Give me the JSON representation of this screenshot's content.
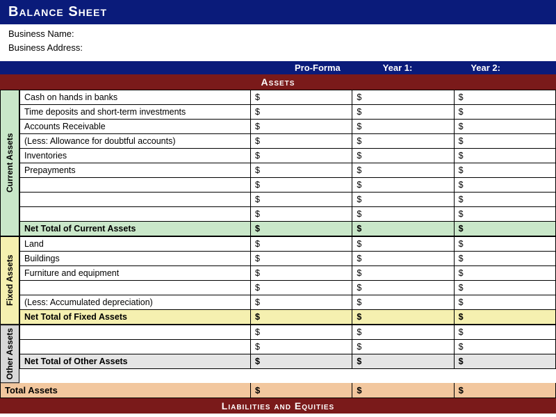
{
  "title": "Balance Sheet",
  "meta": {
    "businessNameLabel": "Business Name:",
    "businessAddressLabel": "Business Address:"
  },
  "columns": {
    "c1": "Pro-Forma",
    "c2": "Year 1:",
    "c3": "Year 2:"
  },
  "sections": {
    "assets": "Assets",
    "liabilities": "Liabilities and Equities"
  },
  "groups": {
    "currentAssets": {
      "label": "Current Assets",
      "rows": [
        "Cash on hands in banks",
        "Time deposits and short-term investments",
        "Accounts Receivable",
        "(Less: Allowance for doubtful accounts)",
        "Inventories",
        "Prepayments",
        "",
        "",
        ""
      ],
      "netLabel": "Net Total of Current Assets"
    },
    "fixedAssets": {
      "label": "Fixed Assets",
      "rows": [
        "Land",
        "Buildings",
        "Furniture and equipment",
        "",
        "(Less: Accumulated depreciation)"
      ],
      "netLabel": "Net Total of Fixed Assets"
    },
    "otherAssets": {
      "label": "Other Assets",
      "rows": [
        "",
        ""
      ],
      "netLabel": "Net Total of Other Assets"
    }
  },
  "totalAssetsLabel": "Total Assets",
  "dollar": "$"
}
